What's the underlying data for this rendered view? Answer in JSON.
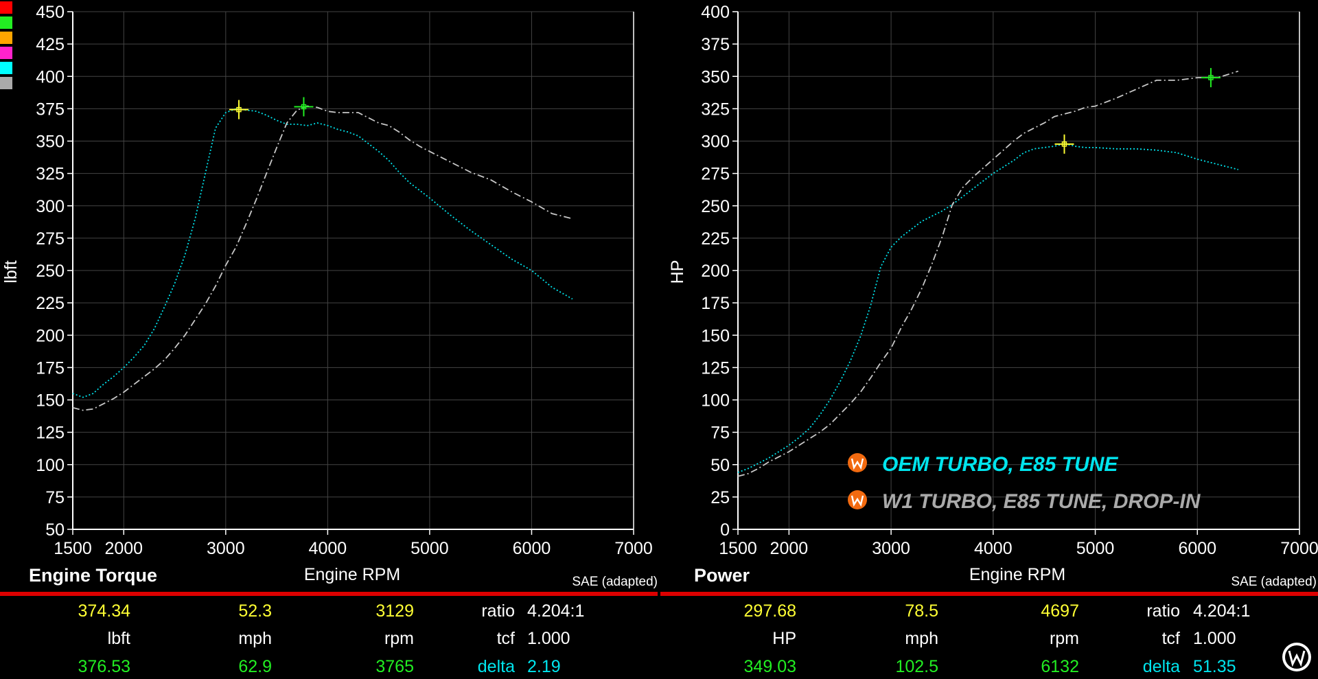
{
  "swatches": [
    "#ff0000",
    "#22ee22",
    "#ffa500",
    "#ff22cc",
    "#00ffff",
    "#aaaaaa"
  ],
  "chart_data": [
    {
      "type": "line",
      "title": "Engine Torque",
      "xlabel": "Engine RPM",
      "ylabel": "lbft",
      "note": "SAE (adapted)",
      "xlim": [
        1500,
        7000
      ],
      "ylim": [
        50,
        450
      ],
      "xticks": [
        1500,
        2000,
        3000,
        4000,
        5000,
        6000,
        7000
      ],
      "yticks": [
        50,
        75,
        100,
        125,
        150,
        175,
        200,
        225,
        250,
        275,
        300,
        325,
        350,
        375,
        400,
        425,
        450
      ],
      "grid": true,
      "series": [
        {
          "color": "#00e5ee",
          "style": "dotted",
          "x": [
            1500,
            1600,
            1700,
            1800,
            1900,
            2000,
            2100,
            2200,
            2300,
            2400,
            2500,
            2600,
            2700,
            2800,
            2900,
            3000,
            3100,
            3200,
            3300,
            3400,
            3500,
            3600,
            3700,
            3800,
            3900,
            4000,
            4100,
            4200,
            4300,
            4400,
            4500,
            4600,
            4700,
            4800,
            4900,
            5000,
            5200,
            5400,
            5600,
            5800,
            6000,
            6200,
            6400
          ],
          "y": [
            155,
            152,
            155,
            162,
            168,
            175,
            183,
            192,
            205,
            222,
            240,
            262,
            290,
            325,
            360,
            372,
            375,
            374,
            373,
            370,
            366,
            363,
            363,
            362,
            364,
            362,
            359,
            357,
            354,
            348,
            342,
            335,
            326,
            318,
            312,
            306,
            293,
            281,
            270,
            259,
            250,
            237,
            228
          ]
        },
        {
          "color": "#c8c8c8",
          "style": "dashdot",
          "x": [
            1500,
            1600,
            1700,
            1800,
            1900,
            2000,
            2100,
            2200,
            2300,
            2400,
            2500,
            2600,
            2700,
            2800,
            2900,
            3000,
            3100,
            3200,
            3300,
            3400,
            3500,
            3600,
            3700,
            3800,
            3900,
            4000,
            4100,
            4200,
            4300,
            4400,
            4500,
            4600,
            4700,
            4800,
            4900,
            5000,
            5200,
            5400,
            5600,
            5800,
            6000,
            6200,
            6400
          ],
          "y": [
            144,
            142,
            143,
            147,
            151,
            156,
            162,
            168,
            174,
            181,
            190,
            200,
            212,
            224,
            238,
            254,
            268,
            286,
            305,
            325,
            345,
            364,
            374,
            377,
            376,
            373,
            372,
            372,
            372,
            368,
            364,
            362,
            357,
            351,
            346,
            342,
            334,
            326,
            320,
            311,
            303,
            294,
            290
          ]
        }
      ],
      "markers": [
        {
          "x": 3129,
          "y": 374.34,
          "color": "#ffff33"
        },
        {
          "x": 3765,
          "y": 376.53,
          "color": "#22ee22"
        }
      ]
    },
    {
      "type": "line",
      "title": "Power",
      "xlabel": "Engine RPM",
      "ylabel": "HP",
      "note": "SAE (adapted)",
      "xlim": [
        1500,
        7000
      ],
      "ylim": [
        0,
        400
      ],
      "xticks": [
        1500,
        2000,
        3000,
        4000,
        5000,
        6000,
        7000
      ],
      "yticks": [
        0,
        25,
        50,
        75,
        100,
        125,
        150,
        175,
        200,
        225,
        250,
        275,
        300,
        325,
        350,
        375,
        400
      ],
      "grid": true,
      "series": [
        {
          "color": "#00e5ee",
          "style": "dotted",
          "x": [
            1500,
            1600,
            1700,
            1800,
            1900,
            2000,
            2100,
            2200,
            2300,
            2400,
            2500,
            2600,
            2700,
            2800,
            2900,
            3000,
            3100,
            3200,
            3300,
            3400,
            3500,
            3600,
            3700,
            3800,
            3900,
            4000,
            4100,
            4200,
            4300,
            4400,
            4500,
            4600,
            4700,
            4800,
            4900,
            5000,
            5200,
            5400,
            5600,
            5800,
            6000,
            6200,
            6400
          ],
          "y": [
            44,
            47,
            51,
            55,
            60,
            65,
            71,
            78,
            88,
            100,
            114,
            130,
            149,
            173,
            203,
            218,
            226,
            232,
            238,
            242,
            246,
            251,
            257,
            263,
            269,
            275,
            280,
            285,
            291,
            294,
            295,
            296,
            298,
            296,
            295,
            295,
            294,
            294,
            293,
            291,
            286,
            282,
            278
          ]
        },
        {
          "color": "#c8c8c8",
          "style": "dashdot",
          "x": [
            1500,
            1600,
            1700,
            1800,
            1900,
            2000,
            2100,
            2200,
            2300,
            2400,
            2500,
            2600,
            2700,
            2800,
            2900,
            3000,
            3100,
            3200,
            3300,
            3400,
            3500,
            3600,
            3700,
            3800,
            3900,
            4000,
            4100,
            4200,
            4300,
            4400,
            4500,
            4600,
            4700,
            4800,
            4900,
            5000,
            5200,
            5400,
            5600,
            5800,
            6000,
            6200,
            6400
          ],
          "y": [
            41,
            43,
            47,
            52,
            56,
            60,
            65,
            70,
            75,
            81,
            89,
            97,
            106,
            117,
            129,
            140,
            156,
            170,
            186,
            205,
            226,
            251,
            264,
            272,
            279,
            286,
            293,
            300,
            306,
            310,
            314,
            319,
            321,
            323,
            326,
            327,
            333,
            340,
            347,
            347,
            349,
            349,
            354
          ]
        }
      ],
      "markers": [
        {
          "x": 4697,
          "y": 297.68,
          "color": "#ffff33"
        },
        {
          "x": 6132,
          "y": 349.03,
          "color": "#22ee22"
        }
      ]
    }
  ],
  "legend": [
    {
      "label": "OEM TURBO, E85 TUNE",
      "color": "#00e5ee"
    },
    {
      "label": "W1 TURBO, E85 TUNE, DROP-IN",
      "color": "#aaaaaa"
    }
  ],
  "readouts": [
    {
      "row1": [
        "374.34",
        "52.3",
        "3129"
      ],
      "row2": [
        "lbft",
        "mph",
        "rpm"
      ],
      "row3": [
        "376.53",
        "62.9",
        "3765"
      ],
      "k1": "ratio",
      "v1": "4.204:1",
      "k2": "tcf",
      "v2": "1.000",
      "k3": "delta",
      "v3": "2.19"
    },
    {
      "row1": [
        "297.68",
        "78.5",
        "4697"
      ],
      "row2": [
        "HP",
        "mph",
        "rpm"
      ],
      "row3": [
        "349.03",
        "102.5",
        "6132"
      ],
      "k1": "ratio",
      "v1": "4.204:1",
      "k2": "tcf",
      "v2": "1.000",
      "k3": "delta",
      "v3": "51.35"
    }
  ]
}
